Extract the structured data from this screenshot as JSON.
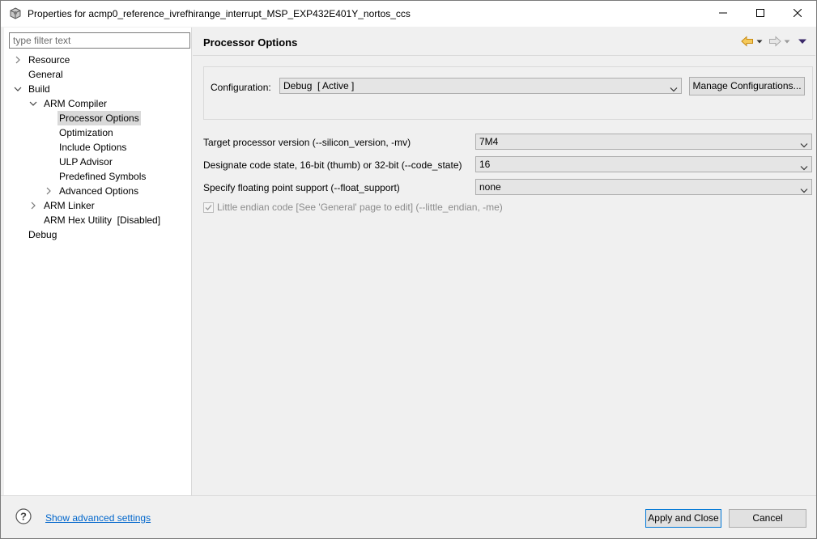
{
  "window": {
    "title": "Properties for acmp0_reference_ivrefhirange_interrupt_MSP_EXP432E401Y_nortos_ccs",
    "icons": {
      "app": "gear-cube-icon",
      "minimize": "minimize-icon",
      "maximize": "maximize-icon",
      "close": "close-icon"
    }
  },
  "sidebar": {
    "filter_placeholder": "type filter text",
    "filter_value": "",
    "items": [
      {
        "label": "Resource",
        "expander": "collapsed"
      },
      {
        "label": "General",
        "expander": "none"
      },
      {
        "label": "Build",
        "expander": "expanded"
      },
      {
        "label": "ARM Compiler",
        "expander": "expanded"
      },
      {
        "label": "Processor Options",
        "expander": "none",
        "selected": true
      },
      {
        "label": "Optimization",
        "expander": "none"
      },
      {
        "label": "Include Options",
        "expander": "none"
      },
      {
        "label": "ULP Advisor",
        "expander": "none"
      },
      {
        "label": "Predefined Symbols",
        "expander": "none"
      },
      {
        "label": "Advanced Options",
        "expander": "collapsed"
      },
      {
        "label": "ARM Linker",
        "expander": "collapsed"
      },
      {
        "label": "ARM Hex Utility  [Disabled]",
        "expander": "none"
      },
      {
        "label": "Debug",
        "expander": "none"
      }
    ]
  },
  "main": {
    "title": "Processor Options",
    "nav_icons": [
      "back-arrow-icon",
      "back-menu-icon",
      "forward-arrow-icon",
      "forward-menu-icon",
      "view-menu-icon"
    ],
    "configuration": {
      "label": "Configuration:",
      "value": "Debug  [ Active ]",
      "manage_button": "Manage Configurations..."
    },
    "options": [
      {
        "label": "Target processor version (--silicon_version, -mv)",
        "value": "7M4"
      },
      {
        "label": "Designate code state, 16-bit (thumb) or 32-bit (--code_state)",
        "value": "16"
      },
      {
        "label": "Specify floating point support (--float_support)",
        "value": "none"
      }
    ],
    "little_endian": {
      "label": "Little endian code [See 'General' page to edit] (--little_endian, -me)",
      "checked": true,
      "disabled": true
    }
  },
  "footer": {
    "advanced_link": "Show advanced settings",
    "apply_close": "Apply and Close",
    "cancel": "Cancel"
  },
  "colors": {
    "accent": "#0078d7",
    "link": "#0066cc",
    "selection": "#d9d9d9",
    "nav_arrow": "#e8a317"
  }
}
